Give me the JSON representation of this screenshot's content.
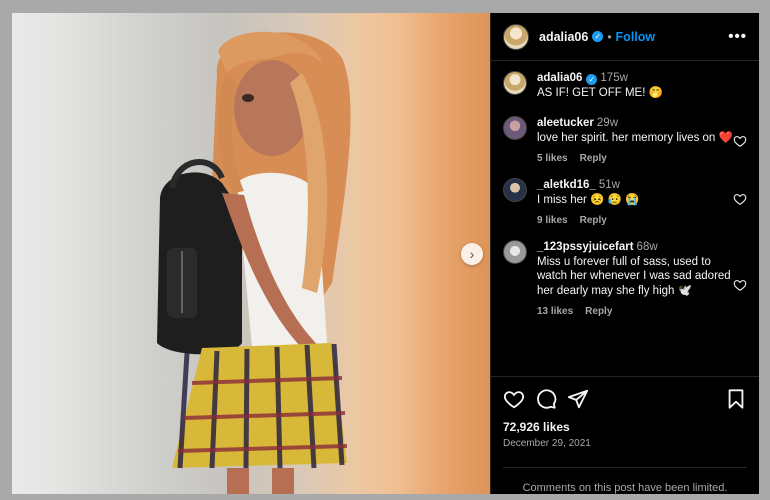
{
  "post": {
    "author": "adalia06",
    "follow_label": "Follow",
    "separator": "•",
    "caption": {
      "username": "adalia06",
      "time": "175w",
      "text": "AS IF! GET OFF ME! 🤭"
    },
    "comments": [
      {
        "username": "aleetucker",
        "time": "29w",
        "text": "love her spirit. her memory lives on ❤️",
        "likes": "5 likes",
        "reply": "Reply"
      },
      {
        "username": "_aletkd16_",
        "time": "51w",
        "text": "I miss her 😣 😥 😭",
        "likes": "9 likes",
        "reply": "Reply"
      },
      {
        "username": "_123pssyjuicefart",
        "time": "68w",
        "text": "Miss u forever full of sass, used to watch her whenever I was sad adored her dearly may she fly high 🕊️",
        "likes": "13 likes",
        "reply": "Reply"
      }
    ],
    "like_count": "72,926 likes",
    "date": "December 29, 2021",
    "comments_notice": "Comments on this post have been limited."
  },
  "colors": {
    "accent": "#0095f6",
    "verified": "#1d9bf0",
    "background": "#000000",
    "muted_text": "#a8a8a8"
  },
  "icons": [
    "verified-badge-icon",
    "more-options-icon",
    "heart-icon",
    "comment-icon",
    "share-icon",
    "bookmark-icon",
    "chevron-right-icon"
  ]
}
